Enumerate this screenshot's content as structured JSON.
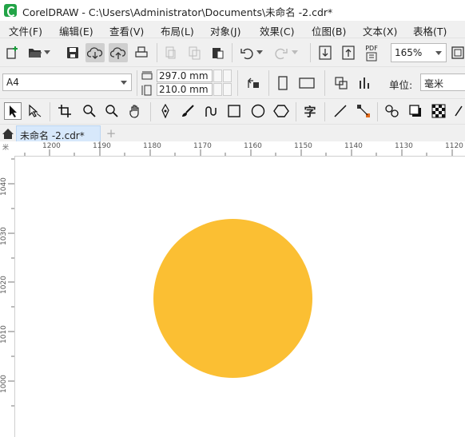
{
  "window": {
    "title": "CorelDRAW - C:\\Users\\Administrator\\Documents\\未命名 -2.cdr*"
  },
  "menu": [
    "文件(F)",
    "编辑(E)",
    "查看(V)",
    "布局(L)",
    "对象(J)",
    "效果(C)",
    "位图(B)",
    "文本(X)",
    "表格(T)"
  ],
  "toolbar": {
    "zoom": "165%",
    "pdf_label": "PDF"
  },
  "property_bar": {
    "page_size": "A4",
    "width": "297.0 mm",
    "height": "210.0 mm",
    "units_label": "单位:",
    "units_value": "毫米"
  },
  "toolbox": {
    "text_tool_glyph": "字"
  },
  "tabs": {
    "document": "未命名 -2.cdr*",
    "new_tab": "+"
  },
  "rulers": {
    "horizontal": [
      "1200",
      "1190",
      "1180",
      "1170",
      "1160",
      "1150",
      "1140",
      "1130",
      "1120"
    ],
    "vertical": [
      "1040",
      "1030",
      "1020",
      "1010",
      "1000"
    ],
    "corner_unit": "米"
  },
  "canvas": {
    "circle_fill": "#fbbf33"
  }
}
